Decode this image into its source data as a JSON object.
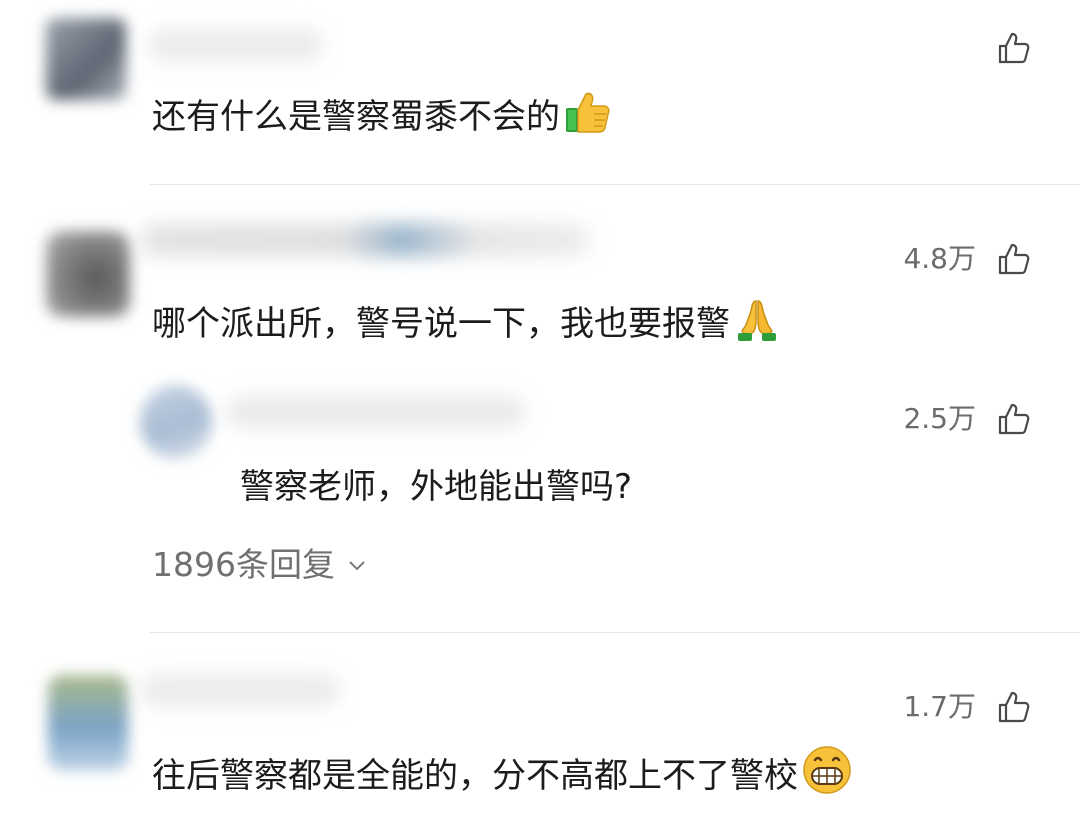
{
  "comments": [
    {
      "text": "还有什么是警察蜀黍不会的",
      "emoji": "thumbs-up-emoji",
      "likes": ""
    },
    {
      "text": "哪个派出所，警号说一下，我也要报警",
      "emoji": "folded-hands-emoji",
      "likes": "4.8万",
      "reply": {
        "text": "警察老师，外地能出警吗?",
        "likes": "2.5万"
      },
      "reply_count": "1896条回复"
    },
    {
      "text": "往后警察都是全能的，分不高都上不了警校",
      "emoji": "grinning-face-emoji",
      "likes": "1.7万"
    }
  ],
  "colors": {
    "text": "#1c1c1c",
    "meta": "#6b6b6b",
    "divider": "#e6e6e6"
  }
}
